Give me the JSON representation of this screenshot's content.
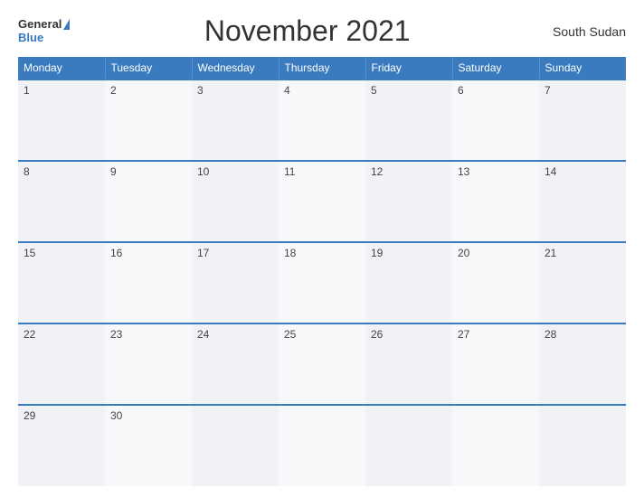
{
  "header": {
    "logo": {
      "general": "General",
      "triangle": "▲",
      "blue": "Blue"
    },
    "title": "November 2021",
    "country": "South Sudan"
  },
  "calendar": {
    "weekdays": [
      "Monday",
      "Tuesday",
      "Wednesday",
      "Thursday",
      "Friday",
      "Saturday",
      "Sunday"
    ],
    "weeks": [
      [
        {
          "day": "1"
        },
        {
          "day": "2"
        },
        {
          "day": "3"
        },
        {
          "day": "4"
        },
        {
          "day": "5"
        },
        {
          "day": "6"
        },
        {
          "day": "7"
        }
      ],
      [
        {
          "day": "8"
        },
        {
          "day": "9"
        },
        {
          "day": "10"
        },
        {
          "day": "11"
        },
        {
          "day": "12"
        },
        {
          "day": "13"
        },
        {
          "day": "14"
        }
      ],
      [
        {
          "day": "15"
        },
        {
          "day": "16"
        },
        {
          "day": "17"
        },
        {
          "day": "18"
        },
        {
          "day": "19"
        },
        {
          "day": "20"
        },
        {
          "day": "21"
        }
      ],
      [
        {
          "day": "22"
        },
        {
          "day": "23"
        },
        {
          "day": "24"
        },
        {
          "day": "25"
        },
        {
          "day": "26"
        },
        {
          "day": "27"
        },
        {
          "day": "28"
        }
      ],
      [
        {
          "day": "29"
        },
        {
          "day": "30"
        },
        {
          "day": ""
        },
        {
          "day": ""
        },
        {
          "day": ""
        },
        {
          "day": ""
        },
        {
          "day": ""
        }
      ]
    ]
  }
}
